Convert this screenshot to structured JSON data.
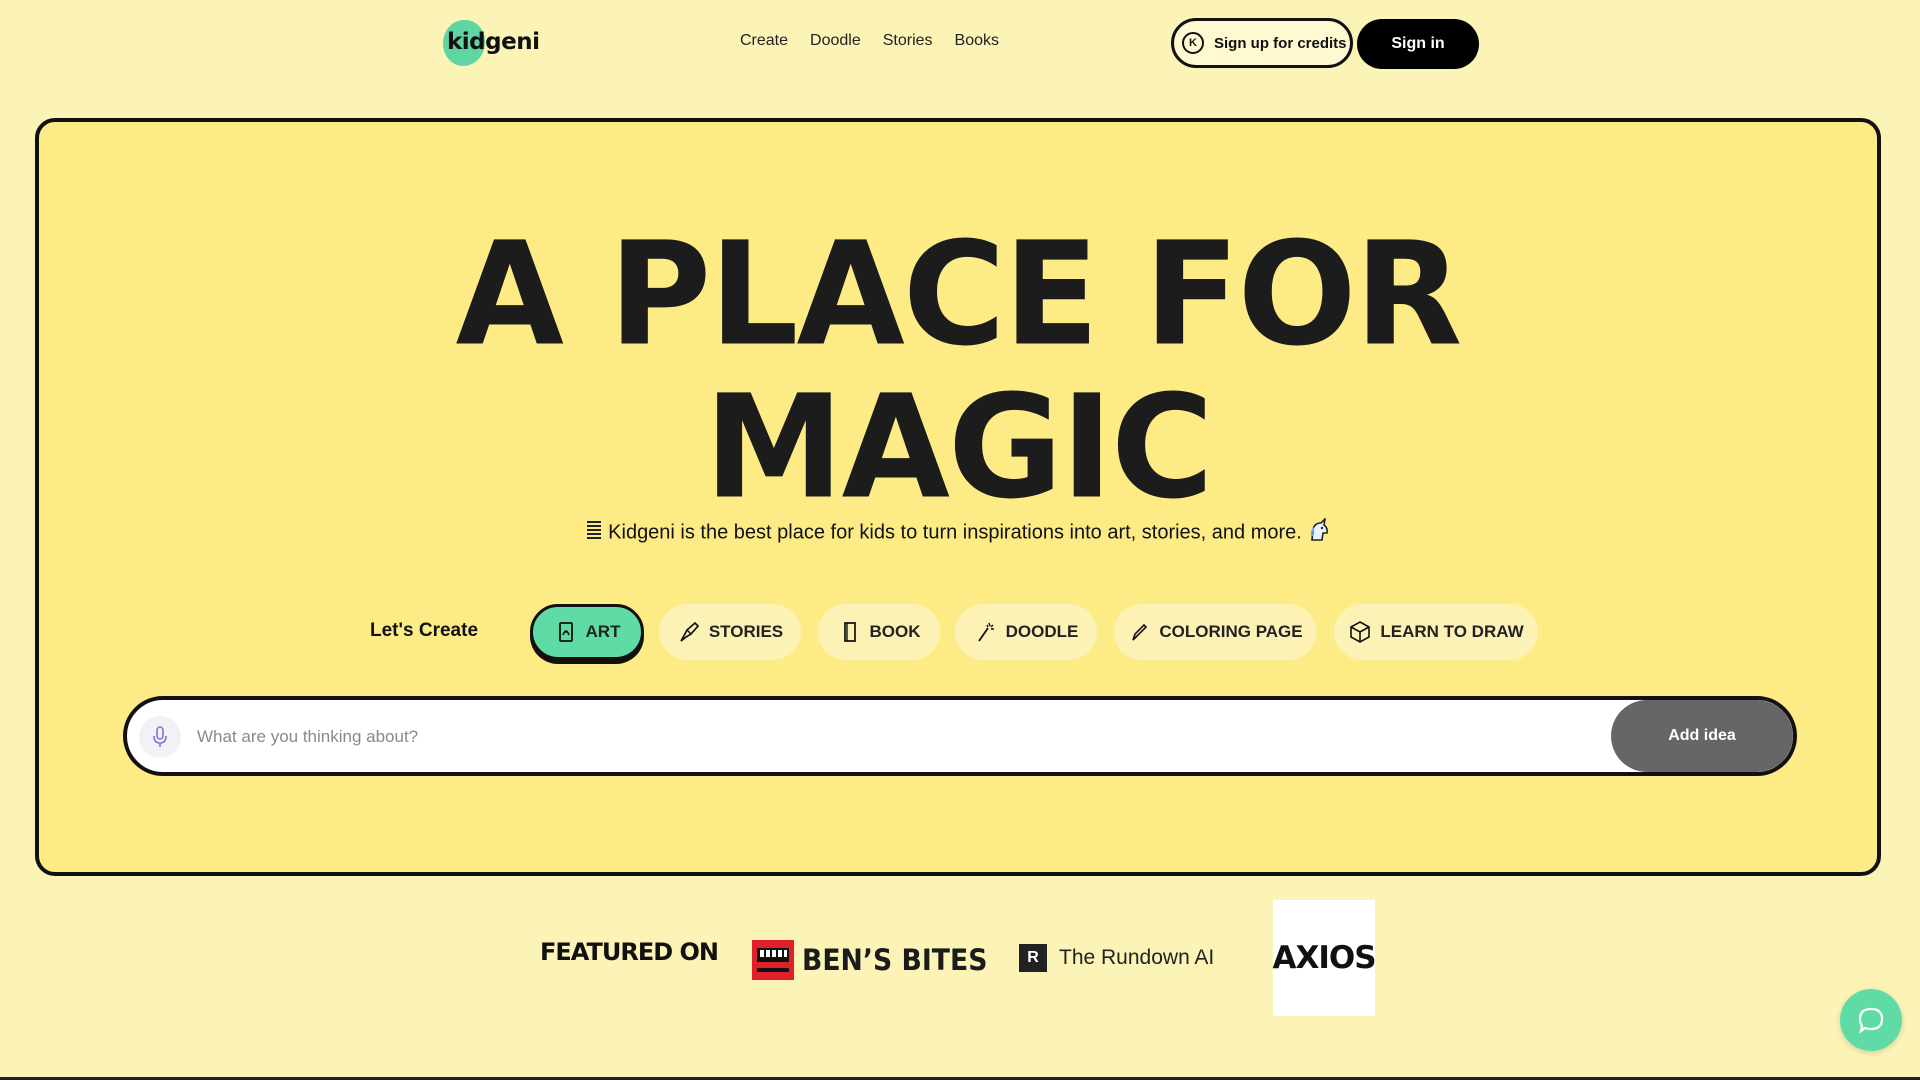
{
  "brand": {
    "name": "kidgeni",
    "accent": "#5fdca6",
    "background": "#fbf4b6",
    "panel": "#fdec85"
  },
  "nav": {
    "items": [
      "Create",
      "Doodle",
      "Stories",
      "Books"
    ]
  },
  "auth": {
    "credits_badge": "K",
    "signup_label": "Sign up for credits",
    "signin_label": "Sign in"
  },
  "hero": {
    "headline_line1": "A PLACE FOR",
    "headline_line2": "MAGIC",
    "tagline": "Kidgeni is the best place for kids to turn inspirations into art, stories, and more."
  },
  "create": {
    "label": "Let's Create",
    "modes": [
      {
        "label": "ART",
        "icon": "art-icon",
        "active": true
      },
      {
        "label": "STORIES",
        "icon": "stories-icon",
        "active": false
      },
      {
        "label": "BOOK",
        "icon": "book-icon",
        "active": false
      },
      {
        "label": "DOODLE",
        "icon": "doodle-icon",
        "active": false
      },
      {
        "label": "COLORING PAGE",
        "icon": "pencil-icon",
        "active": false
      },
      {
        "label": "LEARN TO DRAW",
        "icon": "cube-icon",
        "active": false
      }
    ]
  },
  "prompt": {
    "placeholder": "What are you thinking about?",
    "value": "",
    "submit_label": "Add idea"
  },
  "featured": {
    "label": "FEATURED ON",
    "outlets": [
      "BEN’S BITES",
      "The Rundown AI",
      "AXIOS"
    ],
    "rundown_mark": "R"
  }
}
